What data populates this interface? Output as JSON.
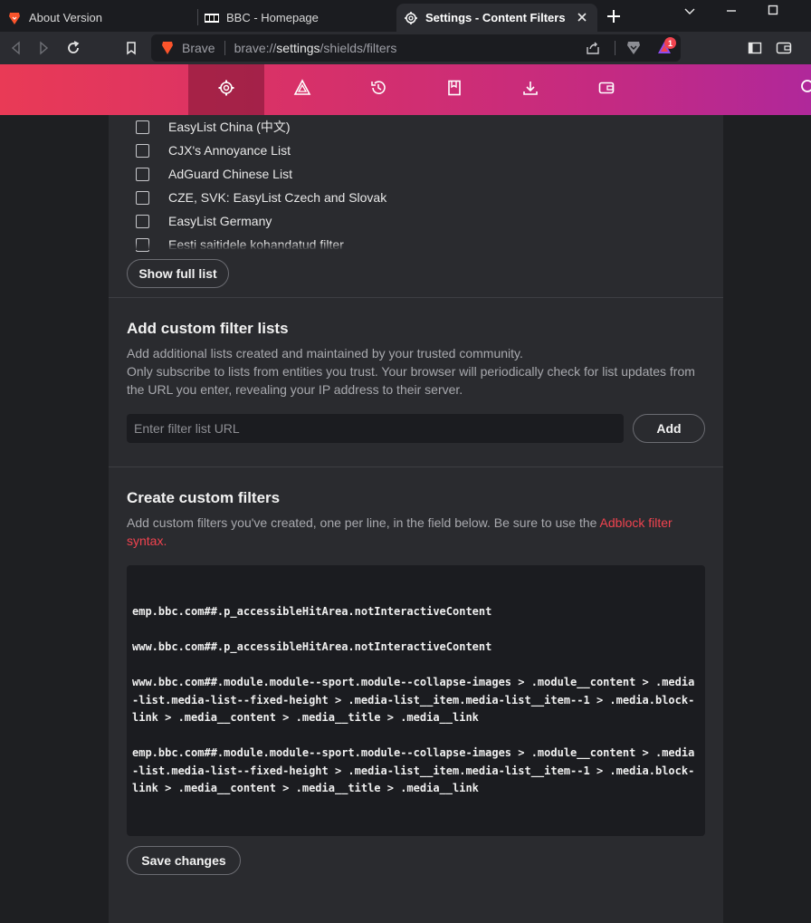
{
  "tabs": [
    {
      "title": "About Version",
      "icon": "brave-lion-icon"
    },
    {
      "title": "BBC - Homepage",
      "icon": "bbc-logo-icon"
    },
    {
      "title": "Settings - Content Filters",
      "icon": "gear-icon",
      "active": true
    }
  ],
  "omnibox": {
    "brand": "Brave",
    "url_prefix": "brave://",
    "url_host": "settings",
    "url_path": "/shields/filters"
  },
  "rewards_badge": "1",
  "filter_lists": [
    {
      "label": "EasyList China (中文)",
      "checked": false
    },
    {
      "label": "CJX's Annoyance List",
      "checked": false
    },
    {
      "label": "AdGuard Chinese List",
      "checked": false
    },
    {
      "label": "CZE, SVK: EasyList Czech and Slovak",
      "checked": false
    },
    {
      "label": "EasyList Germany",
      "checked": false
    },
    {
      "label": "Eesti saitidele kohandatud filter",
      "checked": false
    }
  ],
  "show_full_list_label": "Show full list",
  "custom_lists": {
    "title": "Add custom filter lists",
    "desc_line1": "Add additional lists created and maintained by your trusted community.",
    "desc_line2": "Only subscribe to lists from entities you trust. Your browser will periodically check for list updates from the URL you enter, revealing your IP address to their server.",
    "input_placeholder": "Enter filter list URL",
    "add_label": "Add"
  },
  "custom_filters": {
    "title": "Create custom filters",
    "desc_before_link": "Add custom filters you've created, one per line, in the field below. Be sure to use the ",
    "link_text": "Adblock filter syntax",
    "desc_after_link": ".",
    "lines": [
      "emp.bbc.com##.p_accessibleHitArea.notInteractiveContent",
      "www.bbc.com##.p_accessibleHitArea.notInteractiveContent",
      "www.bbc.com##.module.module--sport.module--collapse-images > .module__content > .media-list.media-list--fixed-height > .media-list__item.media-list__item--1 > .media.block-link > .media__content > .media__title > .media__link",
      "emp.bbc.com##.module.module--sport.module--collapse-images > .module__content > .media-list.media-list--fixed-height > .media-list__item.media-list__item--1 > .media.block-link > .media__content > .media__title > .media__link"
    ],
    "save_label": "Save changes"
  },
  "colors": {
    "accent_red": "#f0434f",
    "nav_gradient_start": "#e93a56",
    "nav_gradient_end": "#b0289a"
  }
}
